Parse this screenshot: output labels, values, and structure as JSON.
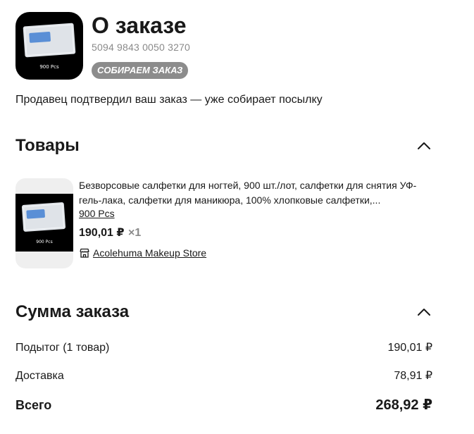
{
  "order": {
    "title": "О заказе",
    "number": "5094 9843 0050 3270",
    "status_badge": "СОБИРАЕМ ЗАКАЗ",
    "status_text": "Продавец подтвердил ваш заказ — уже собирает посылку",
    "thumb_caption": "900 Pcs"
  },
  "items_section": {
    "title": "Товары",
    "chevron_icon": "chevron-up-icon"
  },
  "product": {
    "description": "Безворсовые салфетки для ногтей, 900 шт./лот, салфетки для снятия УФ-гель-лака, салфетки для маникюра, 100% хлопковые салфетки,...",
    "variant": "900 Pcs",
    "price": "190,01 ₽",
    "quantity": "×1",
    "store": "Acolehuma Makeup Store",
    "store_icon": "store-icon",
    "thumb_caption": "900 Pcs"
  },
  "summary_section": {
    "title": "Сумма заказа",
    "chevron_icon": "chevron-up-icon",
    "subtotal_label": "Подытог (1 товар)",
    "subtotal_value": "190,01 ₽",
    "shipping_label": "Доставка",
    "shipping_value": "78,91 ₽",
    "total_label": "Всего",
    "total_value": "268,92 ₽"
  }
}
